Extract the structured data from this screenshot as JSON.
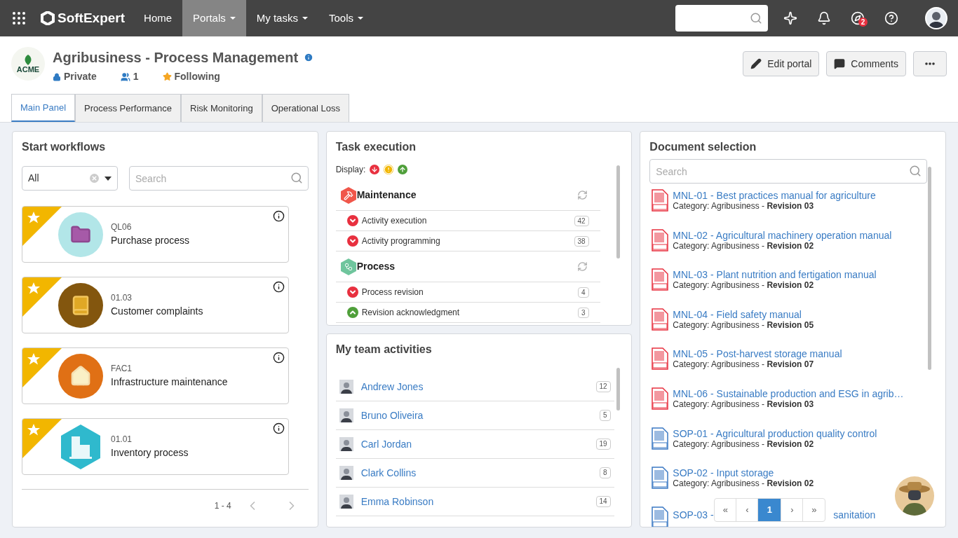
{
  "nav": {
    "brand": "SoftExpert",
    "items": [
      {
        "label": "Home",
        "dropdown": false,
        "selected": false
      },
      {
        "label": "Portals",
        "dropdown": true,
        "selected": true
      },
      {
        "label": "My tasks",
        "dropdown": true,
        "selected": false
      },
      {
        "label": "Tools",
        "dropdown": true,
        "selected": false
      }
    ],
    "notifications_badge": "2"
  },
  "portal": {
    "logo_text": "ACME",
    "title": "Agribusiness - Process Management",
    "privacy": "Private",
    "members": "1",
    "follow": "Following",
    "buttons": [
      "Edit portal",
      "Comments"
    ]
  },
  "tabs": [
    {
      "label": "Main Panel",
      "selected": true
    },
    {
      "label": "Process Performance",
      "selected": false
    },
    {
      "label": "Risk Monitoring",
      "selected": false
    },
    {
      "label": "Operational Loss",
      "selected": false
    }
  ],
  "workflows": {
    "title": "Start workflows",
    "filter": "All",
    "search_placeholder": "Search",
    "pagination": "1 - 4",
    "items": [
      {
        "code": "QL06",
        "name": "Purchase process",
        "kind": "folder",
        "starred": true
      },
      {
        "code": "01.03",
        "name": "Customer complaints",
        "kind": "book",
        "starred": true
      },
      {
        "code": "FAC1",
        "name": "Infrastructure maintenance",
        "kind": "house",
        "starred": true
      },
      {
        "code": "01.01",
        "name": "Inventory process",
        "kind": "building",
        "starred": true
      }
    ]
  },
  "tasks": {
    "title": "Task execution",
    "display_label": "Display:",
    "groups": [
      {
        "name": "Maintenance",
        "kind": "hammer",
        "items": [
          {
            "name": "Activity execution",
            "kind": "late",
            "count": "42"
          },
          {
            "name": "Activity programming",
            "kind": "late",
            "count": "38"
          }
        ]
      },
      {
        "name": "Process",
        "kind": "process",
        "items": [
          {
            "name": "Process revision",
            "kind": "late",
            "count": "4"
          },
          {
            "name": "Revision acknowledgment",
            "kind": "on_time",
            "count": "3"
          }
        ]
      }
    ]
  },
  "team": {
    "title": "My team activities",
    "members": [
      {
        "name": "Andrew Jones",
        "count": "12"
      },
      {
        "name": "Bruno Oliveira",
        "count": "5"
      },
      {
        "name": "Carl Jordan",
        "count": "19"
      },
      {
        "name": "Clark Collins",
        "count": "8"
      },
      {
        "name": "Emma Robinson",
        "count": "14"
      }
    ]
  },
  "documents": {
    "title": "Document selection",
    "search_placeholder": "Search",
    "items": [
      {
        "kind": "pdf",
        "title": "MNL-01 - Best practices manual for agriculture",
        "category": "Category: Agribusiness - ",
        "revision": "Revision 03"
      },
      {
        "kind": "pdf",
        "title": "MNL-02 - Agricultural machinery operation manual",
        "category": "Category: Agribusiness - ",
        "revision": "Revision 02"
      },
      {
        "kind": "pdf",
        "title": "MNL-03 - Plant nutrition and fertigation manual",
        "category": "Category: Agribusiness - ",
        "revision": "Revision 02"
      },
      {
        "kind": "pdf",
        "title": "MNL-04 - Field safety manual",
        "category": "Category: Agribusiness - ",
        "revision": "Revision 05"
      },
      {
        "kind": "pdf",
        "title": "MNL-05 - Post-harvest storage manual",
        "category": "Category: Agribusiness - ",
        "revision": "Revision 07"
      },
      {
        "kind": "pdf",
        "title": "MNL-06 - Sustainable production and ESG in agrib…",
        "category": "Category: Agribusiness - ",
        "revision": "Revision 03"
      },
      {
        "kind": "docx",
        "title": "SOP-01 - Agricultural production quality control",
        "category": "Category: Agribusiness - ",
        "revision": "Revision 02"
      },
      {
        "kind": "docx",
        "title": "SOP-02 - Input storage",
        "category": "Category: Agribusiness - ",
        "revision": "Revision 02"
      }
    ],
    "partial_item": {
      "kind": "docx",
      "title_start": "SOP-03 -",
      "title_end": "sanitation"
    },
    "pager": [
      {
        "label": "«",
        "selected": false
      },
      {
        "label": "‹",
        "selected": false
      },
      {
        "label": "1",
        "selected": true
      },
      {
        "label": "›",
        "selected": false
      },
      {
        "label": "»",
        "selected": false
      }
    ]
  }
}
